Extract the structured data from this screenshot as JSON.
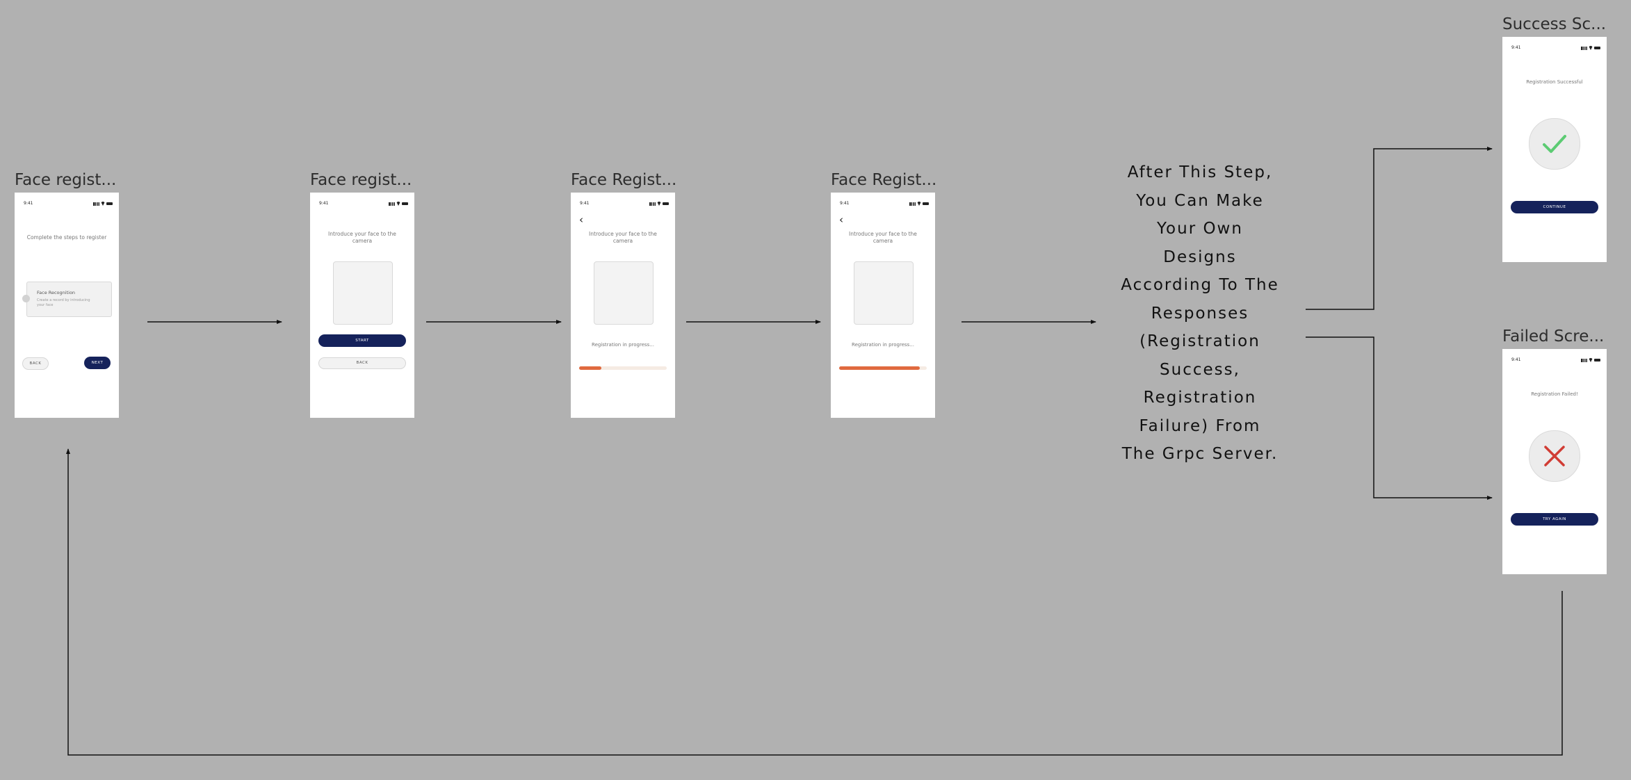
{
  "frames": [
    {
      "label": "Face regist...",
      "title": "Complete the steps to register",
      "card_title": "Face Recognition",
      "card_subtitle": "Create a record by introducing your face",
      "back_label": "BACK",
      "next_label": "NEXT"
    },
    {
      "label": "Face regist...",
      "title": "Introduce your face to the camera",
      "start_label": "START",
      "back_label": "BACK"
    },
    {
      "label": "Face Regist...",
      "title": "Introduce your face to the camera",
      "progress_text": "Registration in progress...",
      "progress": 0.25
    },
    {
      "label": "Face Regist...",
      "title": "Introduce your face to the camera",
      "progress_text": "Registration in progress...",
      "progress": 0.92
    }
  ],
  "status_time": "9:41",
  "success": {
    "label": "Success Sc...",
    "title": "Registration Successful",
    "button": "CONTINUE",
    "icon": "check-icon"
  },
  "failed": {
    "label": "Failed Scre...",
    "title": "Registration Failed!",
    "button": "TRY AGAIN",
    "icon": "cross-icon"
  },
  "description": "After This Step, You Can Make Your Own Designs According To The Responses (Registration Success, Registration Failure) From The Grpc Server.",
  "colors": {
    "background": "#b1b1b1",
    "primary": "#15225b",
    "progress": "#e06a3f",
    "success": "#5ccb73",
    "failure": "#d13c34"
  }
}
